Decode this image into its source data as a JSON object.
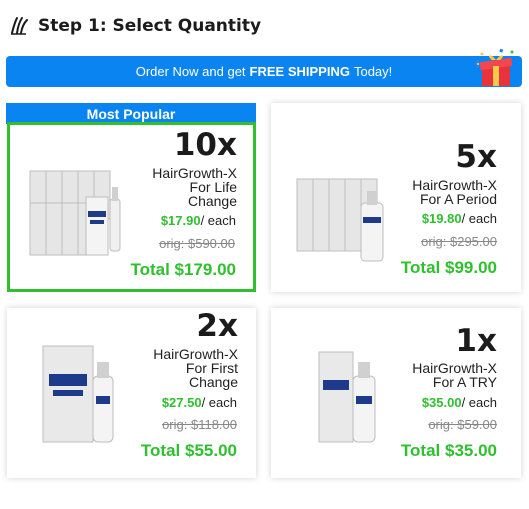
{
  "header": {
    "title": "Step 1: Select Quantity",
    "logo_icon": "hair-logo-icon"
  },
  "banner": {
    "prefix": "Order Now and get",
    "highlight": "FREE SHIPPING",
    "suffix": "Today!",
    "color": "#0a84f0",
    "gift_icon": "gift-box-icon"
  },
  "colors": {
    "accent_green": "#2fbf2f",
    "brand_blue": "#0a84f0"
  },
  "offers": [
    {
      "badge": "Most Popular",
      "quantity": "10x",
      "name_line1": "HairGrowth-X",
      "name_line2": "For Life",
      "name_line3": "Change",
      "price": "$17.90",
      "per": "/ each",
      "orig": "orig: $590.00",
      "total": "Total $179.00"
    },
    {
      "quantity": "5x",
      "name_line1": "HairGrowth-X",
      "name_line2": "For A Period",
      "price": "$19.80",
      "per": "/ each",
      "orig": "orig: $295.00",
      "total": "Total $99.00"
    },
    {
      "quantity": "2x",
      "name_line1": "HairGrowth-X",
      "name_line2": "For First",
      "name_line3": "Change",
      "price": "$27.50",
      "per": "/ each",
      "orig": "orig: $118.00",
      "total": "Total $55.00"
    },
    {
      "quantity": "1x",
      "name_line1": "HairGrowth-X",
      "name_line2": "For A TRY",
      "price": "$35.00",
      "per": "/ each",
      "orig": "orig: $59.00",
      "total": "Total $35.00"
    }
  ]
}
